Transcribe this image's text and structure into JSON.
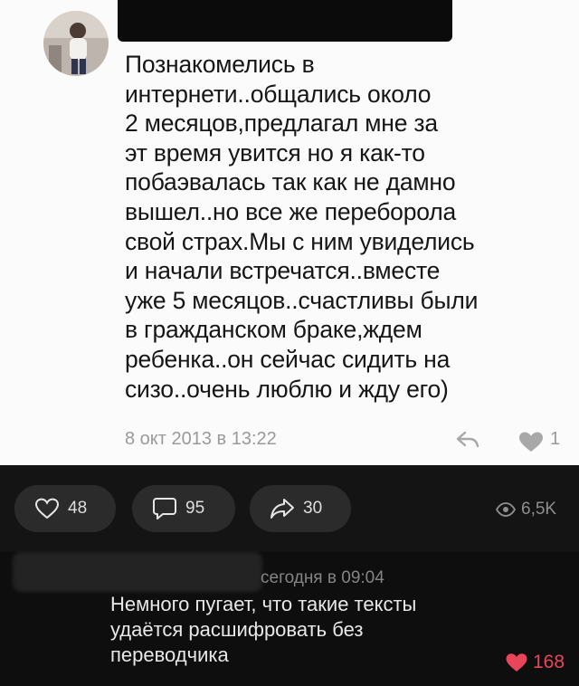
{
  "post": {
    "text": "Познакомелись в\nинтернети..общались около\n2 месяцов,предлагал мне за\nэт время увится но я как-то\nпобаэвалась так как не дамно\nвышел..но все же переборола\nсвой страх.Мы с ним увиделись\nи начали встречатся..вместе\nуже 5 месяцов..счастливы были\nв гражданском браке,ждем\nребенка..он сейчас сидить на\nсизо..очень люблю и жду его)",
    "date": "8 окт 2013 в 13:22",
    "like_count": "1"
  },
  "actions": {
    "likes": "48",
    "comments": "95",
    "shares": "30",
    "views": "6,5K"
  },
  "comment": {
    "time": "сегодня в 09:04",
    "text": "Немного пугает, что такие тексты\nудаётся расшифровать без\nпереводчика",
    "likes": "168"
  },
  "colors": {
    "like_red": "#e9455a",
    "dark_bg": "#0e0e0e",
    "pill_bg": "#2b2b2b"
  }
}
